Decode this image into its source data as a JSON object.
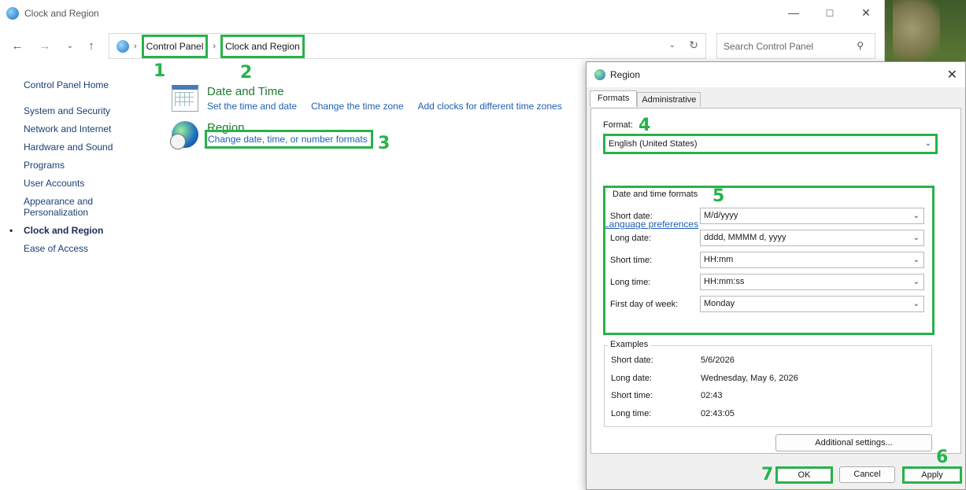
{
  "window": {
    "title": "Clock and Region"
  },
  "address": {
    "crumb_1": "Control Panel",
    "crumb_2": "Clock and Region",
    "search_placeholder": "Search Control Panel"
  },
  "annotations": [
    "1",
    "2",
    "3",
    "4",
    "5",
    "6",
    "7"
  ],
  "accent_color": "#26b34a",
  "left_nav": {
    "home": "Control Panel Home",
    "items": [
      "System and Security",
      "Network and Internet",
      "Hardware and Sound",
      "Programs",
      "User Accounts",
      "Appearance and Personalization",
      "Clock and Region",
      "Ease of Access"
    ],
    "active_index": 6
  },
  "categories": {
    "datetime": {
      "title": "Date and Time",
      "links": [
        "Set the time and date",
        "Change the time zone",
        "Add clocks for different time zones"
      ]
    },
    "region": {
      "title": "Region",
      "links": [
        "Change date, time, or number formats"
      ]
    }
  },
  "dialog": {
    "title": "Region",
    "tabs": [
      "Formats",
      "Administrative"
    ],
    "format_label": "Format:",
    "format_value": "English (United States)",
    "language_link": "Language preferences",
    "dt_group_label": "Date and time formats",
    "fields": [
      {
        "label": "Short date:",
        "value": "M/d/yyyy"
      },
      {
        "label": "Long date:",
        "value": "dddd, MMMM d, yyyy"
      },
      {
        "label": "Short time:",
        "value": "HH:mm"
      },
      {
        "label": "Long time:",
        "value": "HH:mm:ss"
      },
      {
        "label": "First day of week:",
        "value": "Monday"
      }
    ],
    "examples_label": "Examples",
    "examples": [
      {
        "label": "Short date:",
        "value": "5/6/2026"
      },
      {
        "label": "Long date:",
        "value": "Wednesday, May 6, 2026"
      },
      {
        "label": "Short time:",
        "value": "02:43"
      },
      {
        "label": "Long time:",
        "value": "02:43:05"
      }
    ],
    "additional_settings": "Additional settings...",
    "ok": "OK",
    "cancel": "Cancel",
    "apply": "Apply"
  }
}
